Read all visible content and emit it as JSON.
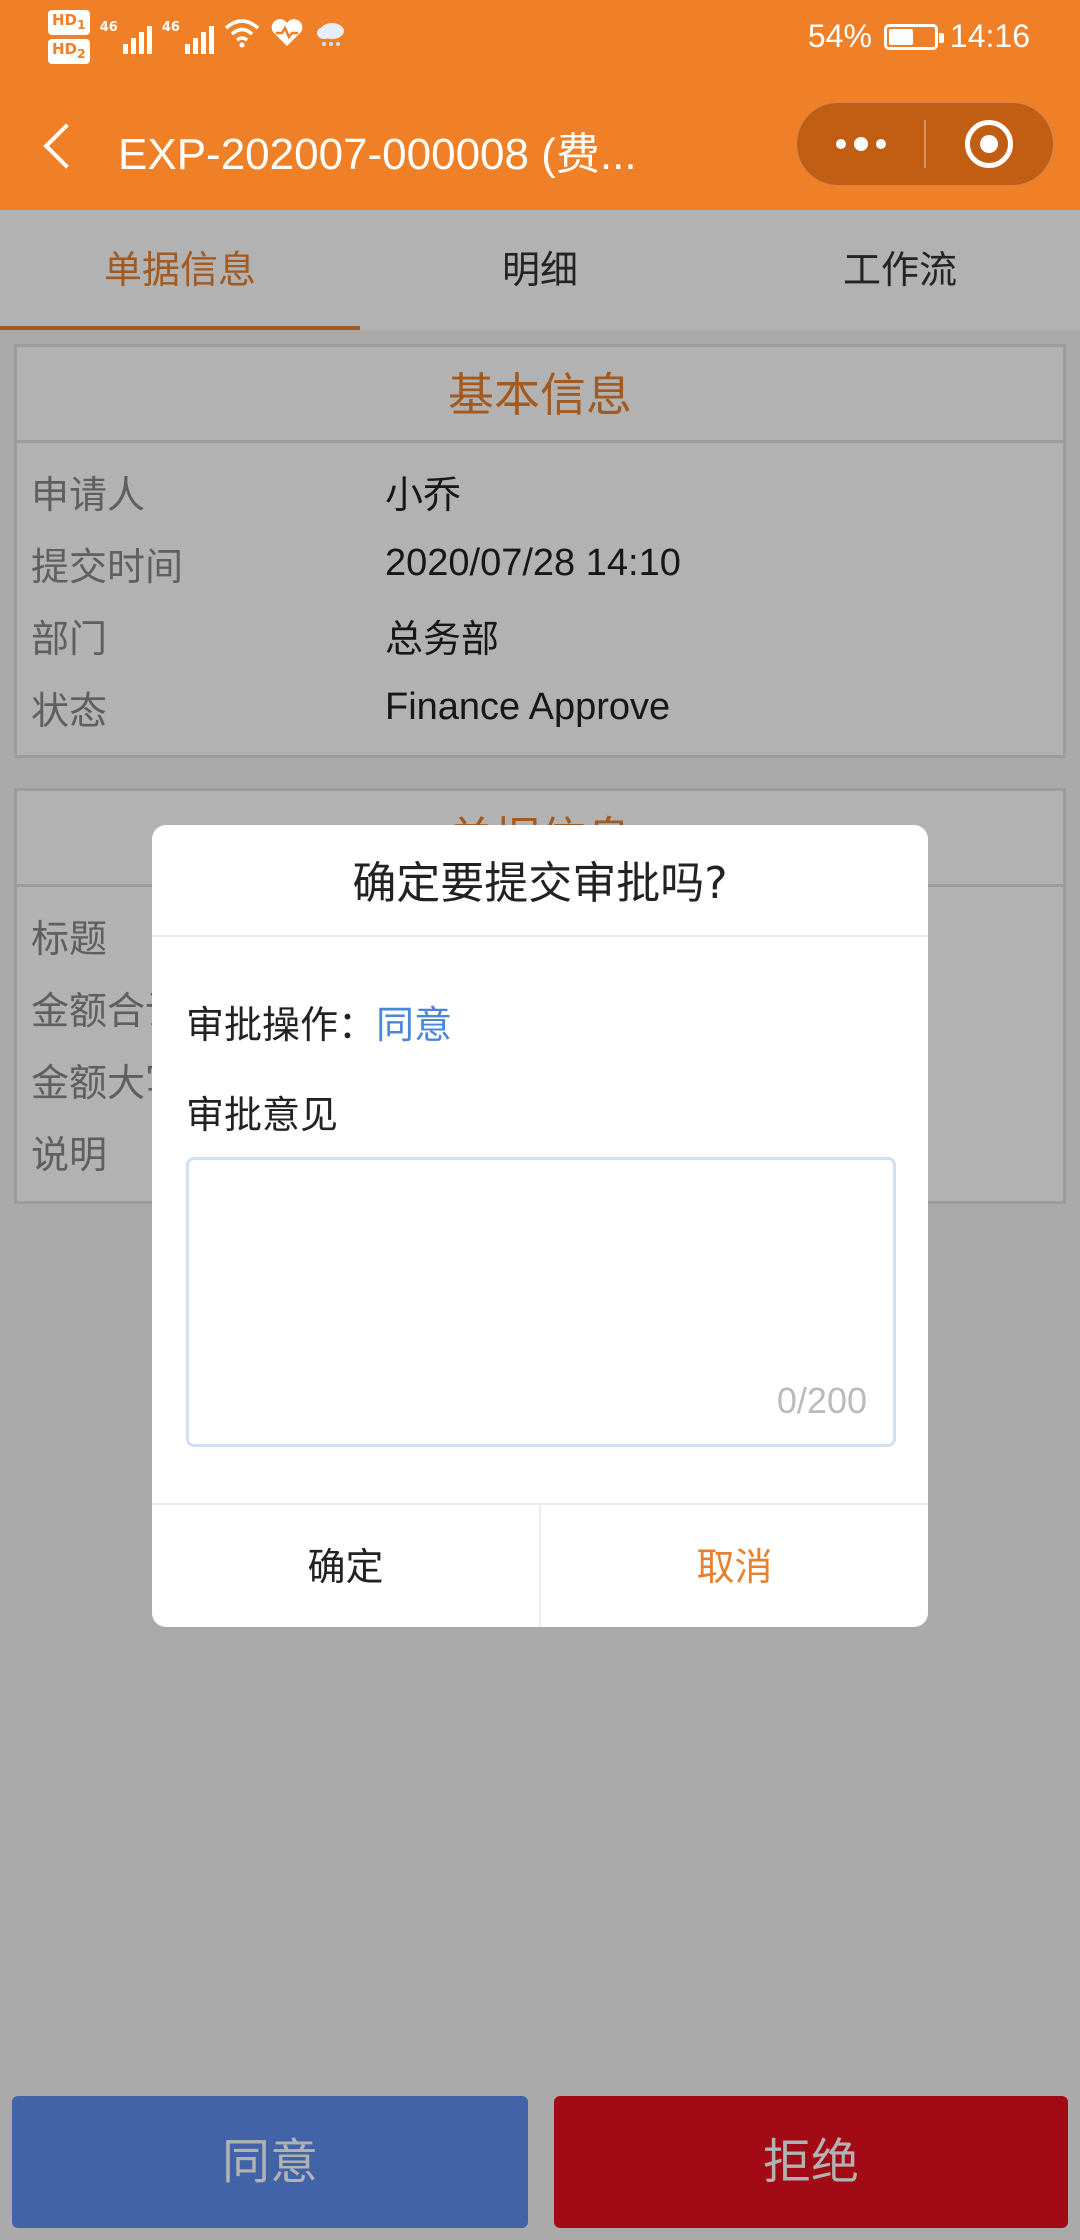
{
  "status_bar": {
    "hd1": "HD",
    "hd1_sub": "1",
    "hd2": "HD",
    "hd2_sub": "2",
    "net1": "46",
    "net2": "46",
    "battery_text": "54%",
    "battery_level": 0.54,
    "time": "14:16",
    "icons": [
      "hd-icon",
      "signal-icon",
      "signal-icon",
      "wifi-icon",
      "health-icon",
      "weather-cloud-icon",
      "battery-icon"
    ]
  },
  "navbar": {
    "title": "EXP-202007-000008 (费...",
    "icons": [
      "back-icon",
      "more-icon",
      "close-target-icon"
    ]
  },
  "tabs": [
    {
      "label": "单据信息",
      "active": true
    },
    {
      "label": "明细",
      "active": false
    },
    {
      "label": "工作流",
      "active": false
    }
  ],
  "basic_info": {
    "title": "基本信息",
    "rows": [
      {
        "label": "申请人",
        "value": "小乔"
      },
      {
        "label": "提交时间",
        "value": "2020/07/28 14:10"
      },
      {
        "label": "部门",
        "value": "总务部"
      },
      {
        "label": "状态",
        "value": "Finance Approve"
      }
    ]
  },
  "doc_info": {
    "title": "单据信息",
    "rows": [
      {
        "label": "标题",
        "value": ""
      },
      {
        "label": "金额合计",
        "value": ""
      },
      {
        "label": "金额大写",
        "value": ""
      },
      {
        "label": "说明",
        "value": ""
      }
    ]
  },
  "bottom_bar": {
    "approve_label": "同意",
    "reject_label": "拒绝",
    "approve_color": "#5f8ef0",
    "reject_color": "#e8101f"
  },
  "dialog": {
    "title": "确定要提交审批吗?",
    "operation_label": "审批操作：",
    "operation_value": "同意",
    "opinion_label": "审批意见",
    "opinion_value": "",
    "counter": "0/200",
    "ok_label": "确定",
    "cancel_label": "取消"
  },
  "colors": {
    "brand": "#f08027",
    "accent": "#e8812f",
    "link": "#4a87d8"
  }
}
